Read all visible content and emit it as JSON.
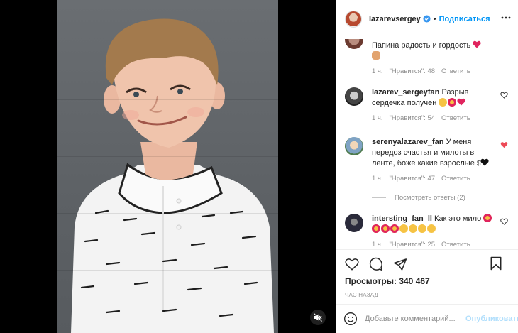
{
  "post": {
    "username": "lazarevsergey",
    "follow_label": "Подписаться",
    "separator": "•"
  },
  "comments": [
    {
      "text": "Папина радость и гордость",
      "time": "1 ч.",
      "likes": "\"Нравится\": 48",
      "reply": "Ответить"
    },
    {
      "user": "lazarev_sergeyfan",
      "text": "Разрыв сердечка получен",
      "time": "1 ч.",
      "likes": "\"Нравится\": 54",
      "reply": "Ответить"
    },
    {
      "user": "serenyalazarev_fan",
      "text": "У меня передоз счастья и милоты в ленте, боже какие взрослые",
      "time": "1 ч.",
      "likes": "\"Нравится\": 47",
      "reply": "Ответить",
      "view_replies": "Посмотреть ответы (2)"
    },
    {
      "user": "intersting_fan_ll",
      "text": "Как это мило",
      "time": "1 ч.",
      "likes": "\"Нравится\": 25",
      "reply": "Ответить"
    }
  ],
  "stats": {
    "views": "Просмотры: 340 467",
    "time_ago": "час назад"
  },
  "comment_box": {
    "placeholder": "Добавьте комментарий...",
    "publish": "Опубликовать"
  },
  "colors": {
    "accent": "#0095f6",
    "liked_heart": "#ed4956",
    "muted_text": "#8e8e8e"
  },
  "icons": [
    "mute-icon",
    "verified-badge-icon",
    "more-options-icon",
    "heart-icon",
    "comment-icon",
    "share-icon",
    "bookmark-icon",
    "emoji-icon"
  ]
}
